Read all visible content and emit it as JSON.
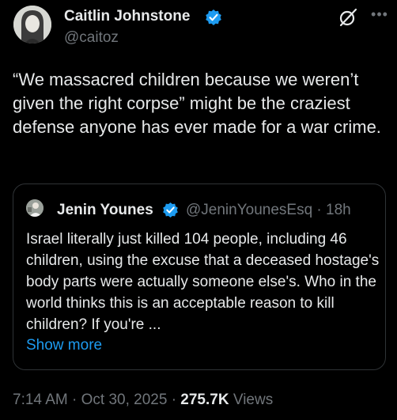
{
  "author": {
    "name": "Caitlin Johnstone",
    "handle": "@caitoz",
    "verified": true
  },
  "tweet": {
    "text": "“We massacred children because we weren’t given the right corpse” might be the craziest defense anyone has ever made for a war crime."
  },
  "quoted_tweet": {
    "name": "Jenin Younes",
    "handle_time": "@JeninYounesEsq · 18h",
    "verified": true,
    "text": "Israel literally just killed 104 people, including 46 children, using the excuse that a deceased hostage's body parts were actually someone else's.  Who in the world thinks this is an acceptable reason to kill children?  If you're ...",
    "show_more": "Show more"
  },
  "meta": {
    "time": "7:14 AM",
    "date": "Oct 30, 2025",
    "views_count": "275.7K",
    "views_label": "Views"
  },
  "icons": {
    "verified": "verified-badge-icon",
    "grok": "grok-icon",
    "more": "more-options-icon"
  },
  "colors": {
    "background": "#000000",
    "text": "#e7e9ea",
    "secondary": "#71767b",
    "accent": "#1d9bf0",
    "border": "#2f3336"
  }
}
